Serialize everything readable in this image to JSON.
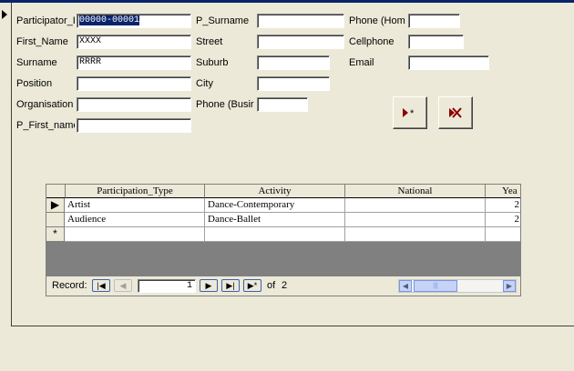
{
  "form": {
    "participator_id": {
      "label": "Participator_I",
      "value": "00000-00001"
    },
    "first_name": {
      "label": "First_Name",
      "value": "XXXX"
    },
    "surname": {
      "label": "Surname",
      "value": "RRRR"
    },
    "position": {
      "label": "Position",
      "value": ""
    },
    "organisation": {
      "label": "Organisation",
      "value": ""
    },
    "p_first_name": {
      "label": "P_First_name",
      "value": ""
    },
    "p_surname": {
      "label": "P_Surname",
      "value": ""
    },
    "street": {
      "label": "Street",
      "value": ""
    },
    "suburb": {
      "label": "Suburb",
      "value": ""
    },
    "city": {
      "label": "City",
      "value": ""
    },
    "phone_business": {
      "label": "Phone (Busir",
      "value": ""
    },
    "phone_home": {
      "label": "Phone (Hom",
      "value": ""
    },
    "cellphone": {
      "label": "Cellphone",
      "value": ""
    },
    "email": {
      "label": "Email",
      "value": ""
    }
  },
  "buttons": {
    "new_record_icon": "new-record-icon",
    "delete_record_icon": "delete-record-icon"
  },
  "subform": {
    "columns": [
      "Participation_Type",
      "Activity",
      "National",
      "Yea"
    ],
    "rows": [
      {
        "type": "Artist",
        "activity": "Dance-Contemporary",
        "national": "",
        "year": "2"
      },
      {
        "type": "Audience",
        "activity": "Dance-Ballet",
        "national": "",
        "year": "2"
      }
    ],
    "new_row_marker": "*",
    "current_row_marker": "▶"
  },
  "navigator": {
    "label": "Record:",
    "current": "1",
    "of_label": "of",
    "total": "2"
  },
  "colors": {
    "background": "#ece9d8",
    "selection": "#0a246a",
    "grid_empty": "#808080"
  }
}
